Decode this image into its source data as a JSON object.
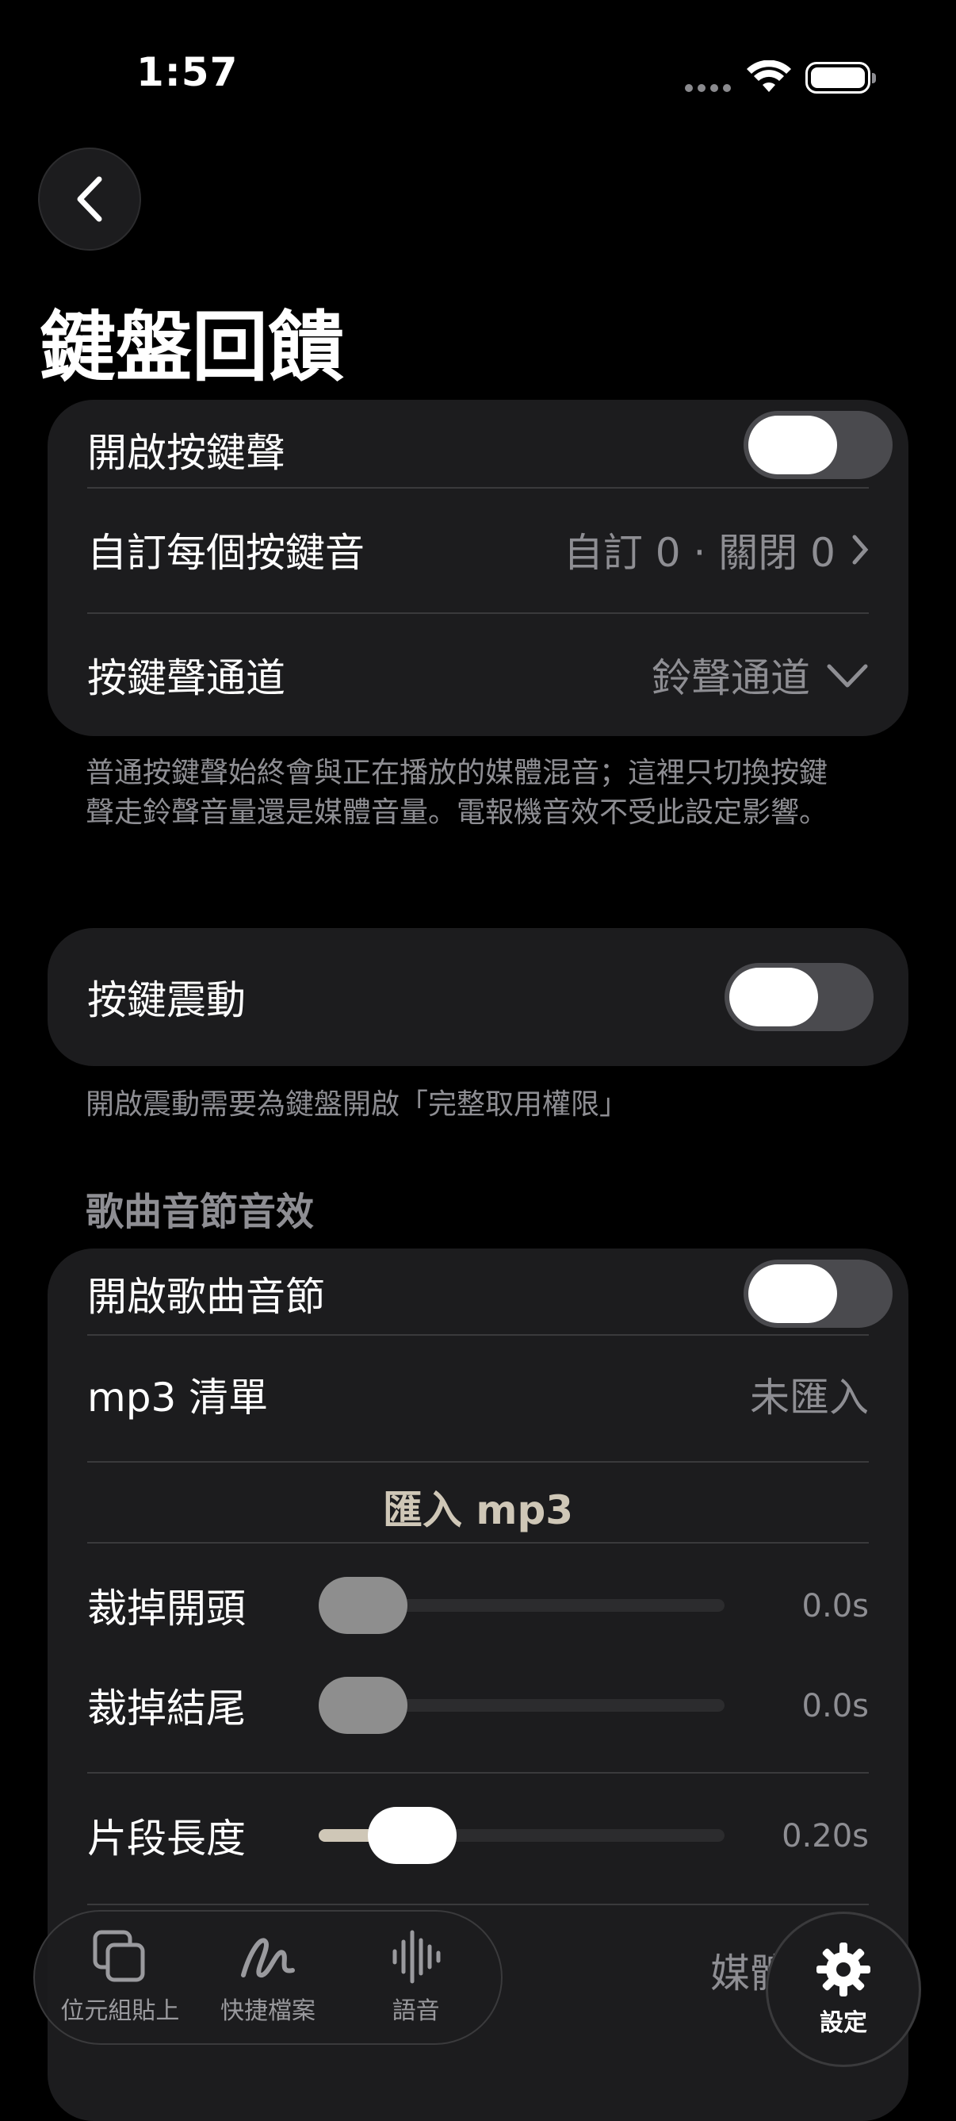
{
  "status_bar": {
    "time": "1:57"
  },
  "page": {
    "title": "鍵盤回饋"
  },
  "sound_group": {
    "key_sound_label": "開啟按鍵聲",
    "key_sound_on": false,
    "custom_label": "自訂每個按鍵音",
    "custom_value": "自訂 0 · 關閉 0",
    "channel_label": "按鍵聲通道",
    "channel_value": "鈴聲通道",
    "note": "普通按鍵聲始終會與正在播放的媒體混音；這裡只切換按鍵聲走鈴聲音量還是媒體音量。電報機音效不受此設定影響。"
  },
  "haptic_group": {
    "label": "按鍵震動",
    "on": false,
    "note": "開啟震動需要為鍵盤開啟「完整取用權限」"
  },
  "song_section": {
    "header": "歌曲音節音效",
    "enable_label": "開啟歌曲音節",
    "enable_on": false,
    "mp3_list_label": "mp3 清單",
    "mp3_list_value": "未匯入",
    "import_label": "匯入 mp3",
    "trim_start_label": "裁掉開頭",
    "trim_start_value": "0.0s",
    "trim_start_level": 0,
    "trim_end_label": "裁掉結尾",
    "trim_end_value": "0.0s",
    "trim_end_level": 0,
    "segment_label": "片段長度",
    "segment_value": "0.20s",
    "segment_level": 0.12,
    "channel_partial_value": "媒體通道"
  },
  "tabbar": {
    "tabs": [
      {
        "label": "位元組貼上",
        "icon": "copy-icon"
      },
      {
        "label": "快捷檔案",
        "icon": "scribble-icon"
      },
      {
        "label": "語音",
        "icon": "waveform-icon"
      }
    ],
    "settings_label": "設定",
    "settings_icon": "gear-icon"
  },
  "colors": {
    "background": "#000000",
    "card": "#1c1c1e",
    "accent": "#cfc7b7",
    "secondary_text": "#8e8e93"
  }
}
